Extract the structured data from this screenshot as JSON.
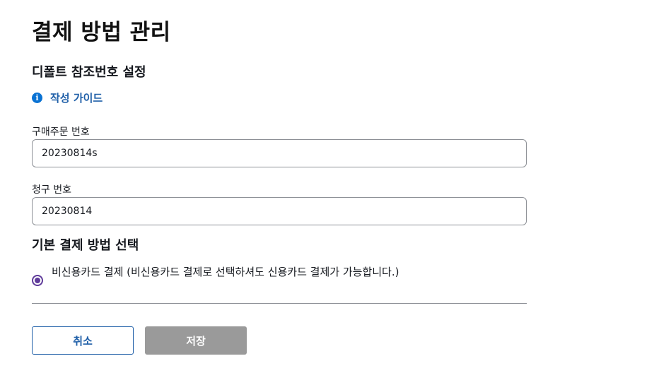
{
  "page": {
    "title": "결제 방법 관리"
  },
  "reference": {
    "section_title": "디폴트 참조번호 설정",
    "guide_link": "작성 가이드",
    "guide_icon": "info-icon",
    "purchase_order": {
      "label": "구매주문 번호",
      "value": "20230814s"
    },
    "invoice": {
      "label": "청구 번호",
      "value": "20230814"
    }
  },
  "payment_method": {
    "section_title": "기본 결제 방법 선택",
    "options": [
      {
        "label": "비신용카드 결제 (비신용카드 결제로 선택하셔도 신용카드 결제가 가능합니다.)",
        "selected": true
      }
    ]
  },
  "actions": {
    "cancel_label": "취소",
    "save_label": "저장",
    "save_disabled": true
  },
  "colors": {
    "link": "#1f5fa8",
    "radio": "#5f3b9a",
    "disabled_button": "#9a9a9a"
  }
}
